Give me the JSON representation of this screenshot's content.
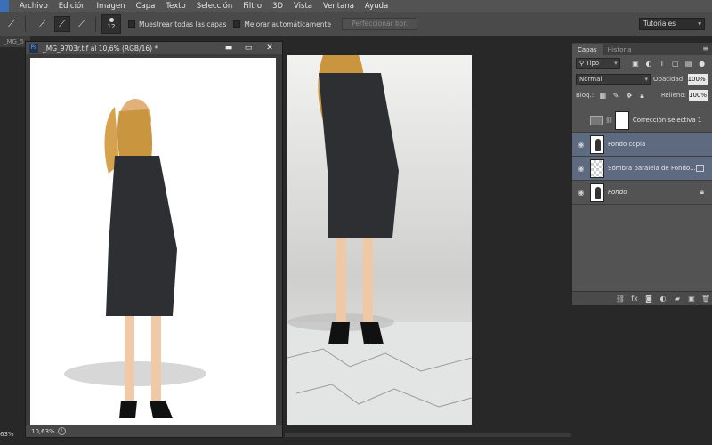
{
  "menubar": {
    "items": [
      "Archivo",
      "Edición",
      "Imagen",
      "Capa",
      "Texto",
      "Selección",
      "Filtro",
      "3D",
      "Vista",
      "Ventana",
      "Ayuda"
    ]
  },
  "options": {
    "brush_size": "12",
    "sample_all_layers": "Muestrear todas las capas",
    "auto_enhance": "Mejorar automáticamente",
    "refine_edge": "Perfeccionar bor.",
    "workspace": "Tutoriales"
  },
  "back_tab": "_MG_5",
  "document": {
    "ps_badge": "Ps",
    "title": "_MG_9703r.tif al 10,6% (RGB/16) *",
    "zoom": "10,63%",
    "btn_min": "▬",
    "btn_max": "▭",
    "btn_close": "✕"
  },
  "layers_panel": {
    "tabs": [
      "Capas",
      "Historia"
    ],
    "filter_kind": "Tipo",
    "blend_mode": "Normal",
    "opacity_label": "Opacidad:",
    "opacity": "100%",
    "lock_label": "Bloq.:",
    "fill_label": "Relleno:",
    "fill": "100%",
    "layers": [
      {
        "name": "Corrección selectiva 1",
        "visible": false,
        "selected": false
      },
      {
        "name": "Fondo copia",
        "visible": true,
        "selected": true
      },
      {
        "name": "Sombra paralela de Fondo...",
        "visible": true,
        "selected": true
      },
      {
        "name": "Fondo",
        "visible": true,
        "selected": false
      }
    ]
  },
  "bottom_zoom": "63%",
  "icons": {
    "eye": "eye-icon",
    "lock": "lock-icon",
    "link": "link-icon",
    "fx": "fx-icon",
    "mask": "mask-icon",
    "adjustment": "adjustment-icon",
    "group": "folder-icon",
    "new_layer": "new-layer-icon",
    "trash": "trash-icon"
  },
  "colors": {
    "selection_highlight": "#5d6a80",
    "panel_bg": "#535353",
    "app_bg": "#282828"
  }
}
